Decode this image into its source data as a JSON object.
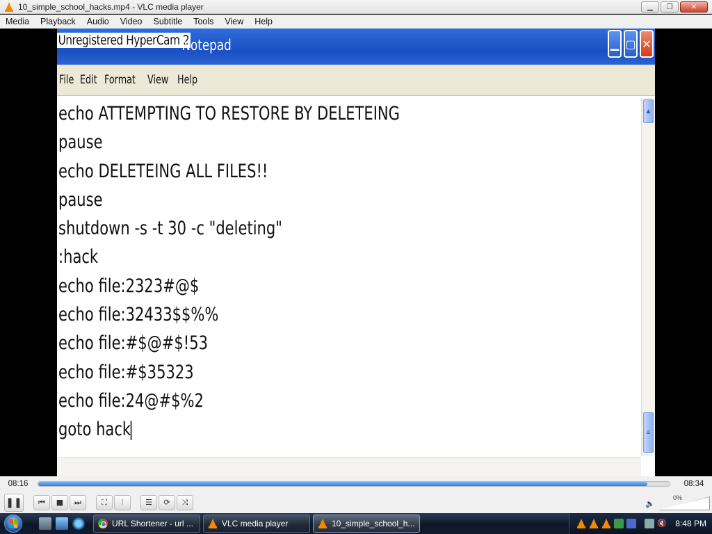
{
  "vlc": {
    "title": "10_simple_school_hacks.mp4 - VLC media player",
    "menu": [
      "Media",
      "Playback",
      "Audio",
      "Video",
      "Subtitle",
      "Tools",
      "View",
      "Help"
    ],
    "time_elapsed": "08:16",
    "time_total": "08:34",
    "progress_percent": 96.5,
    "volume_percent": "0%",
    "window_buttons": [
      "minimize-icon",
      "restore-icon",
      "close-icon"
    ]
  },
  "video": {
    "watermark": "Unregistered HyperCam 2",
    "notepad_title": "- Notepad",
    "notepad_menu": [
      "File",
      "Edit",
      "Format",
      "View",
      "Help"
    ],
    "notepad_lines": [
      "echo ATTEMPTING TO RESTORE BY DELETEING",
      "pause",
      "echo DELETEING ALL FILES!!",
      "pause",
      "shutdown -s -t 30 -c \"deleting\"",
      ":hack",
      "echo file:2323#@$",
      "echo file:32433$$%%",
      "echo file:#$@#$!53",
      "echo file:#$35323",
      "echo file:24@#$%2",
      "goto hack"
    ]
  },
  "taskbar": {
    "tasks": [
      {
        "label": "URL Shortener - url ...",
        "icon": "chrome-icon",
        "active": false
      },
      {
        "label": "VLC media player",
        "icon": "vlc-icon",
        "active": false
      },
      {
        "label": "10_simple_school_h...",
        "icon": "vlc-icon",
        "active": true
      }
    ],
    "clock": "8:48 PM"
  },
  "colors": {
    "xp_title_blue": "#1a4fc4",
    "vlc_orange": "#f08a00",
    "seek_blue": "#2f7ee0",
    "taskbar_dark": "#0e1726"
  }
}
